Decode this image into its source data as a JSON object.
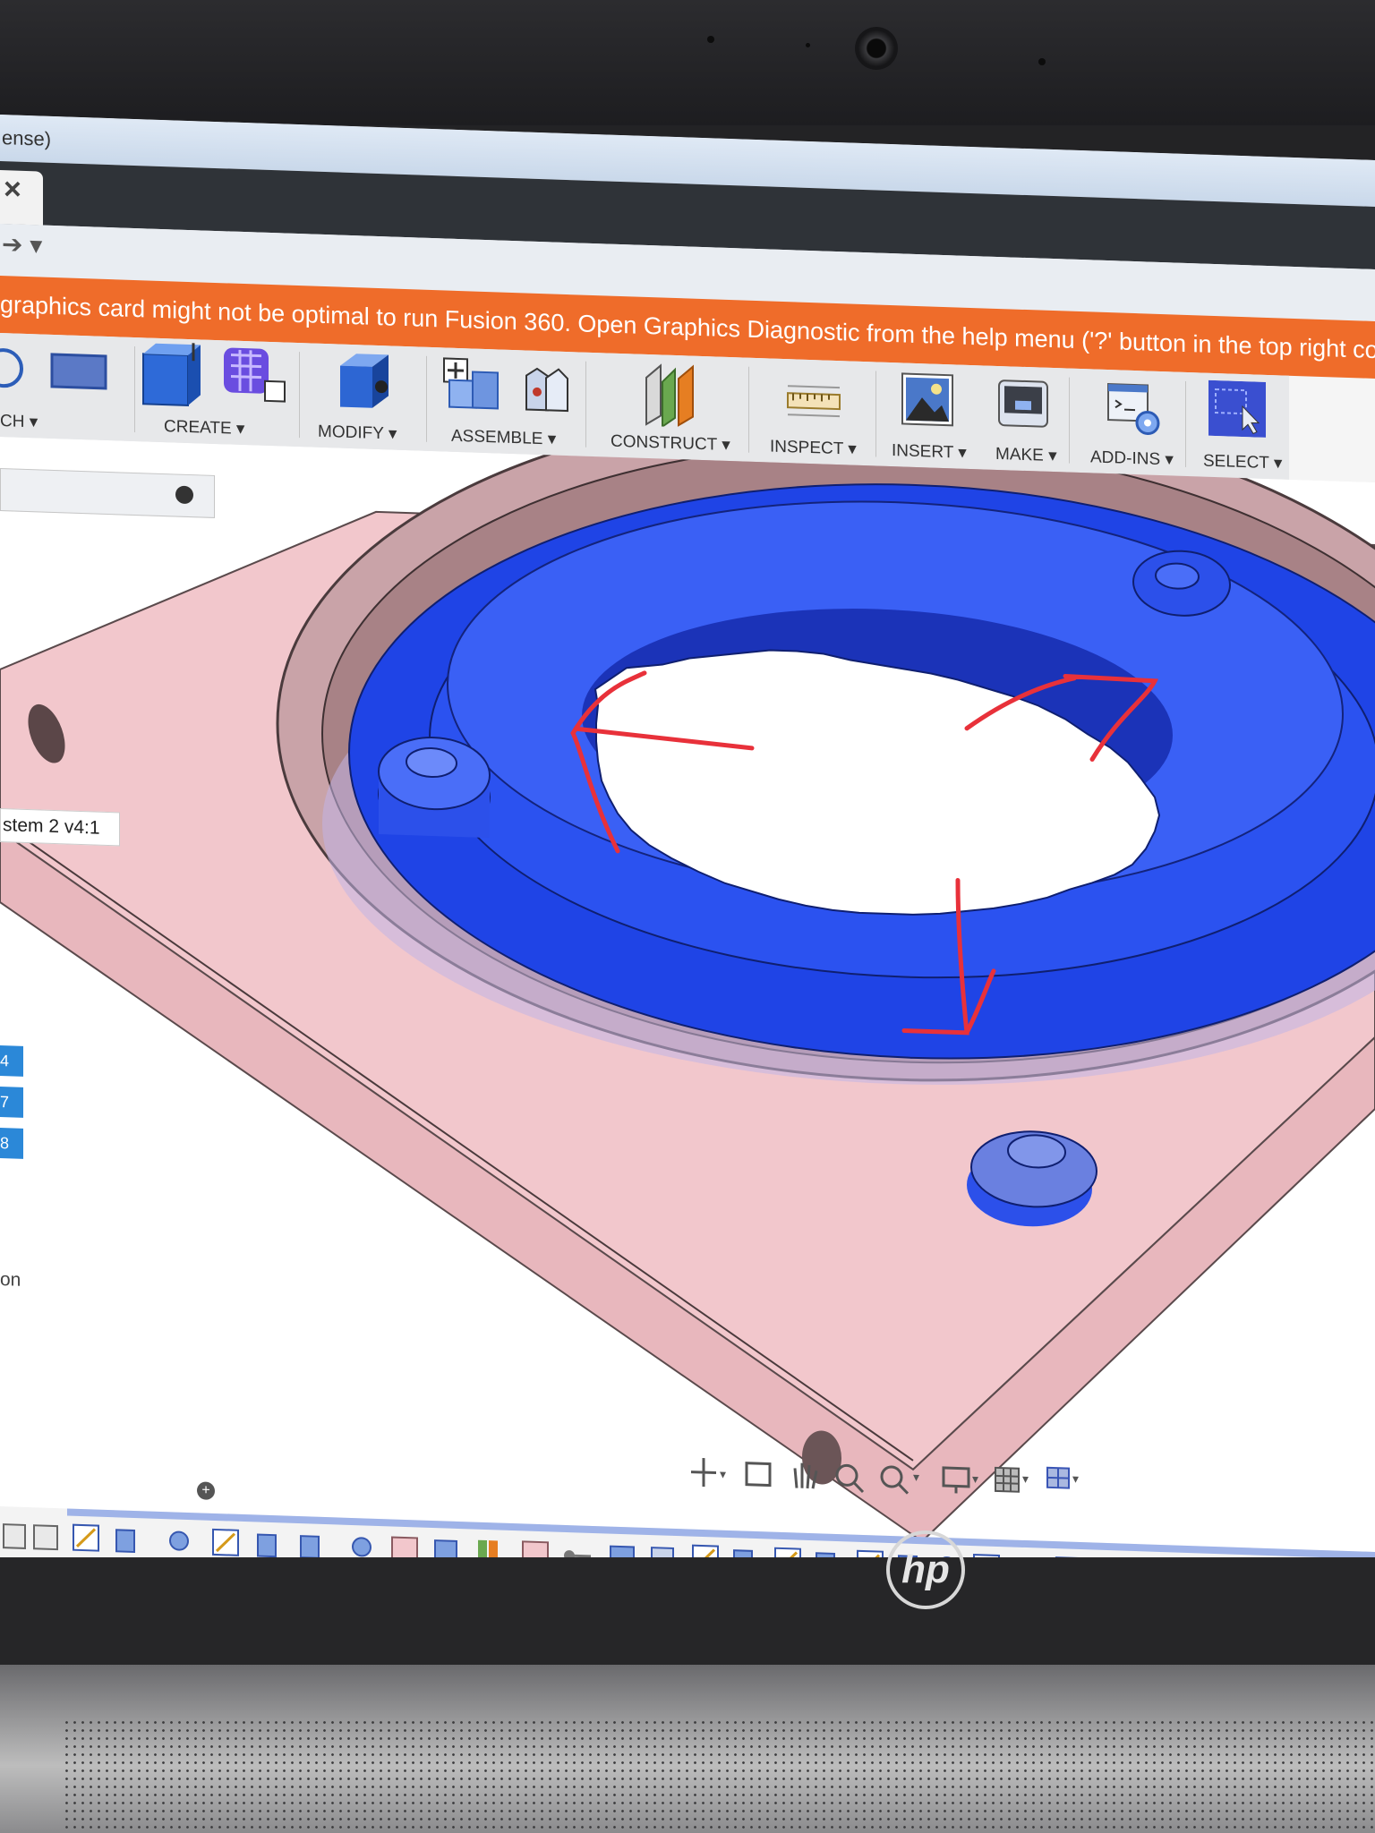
{
  "window": {
    "title_fragment": "ense)"
  },
  "tab": {
    "close_glyph": "×"
  },
  "warning": {
    "text": "graphics card might not be optimal to run Fusion 360. Open Graphics Diagnostic from the help menu ('?' button in the top right co"
  },
  "toolbar": {
    "groups": [
      {
        "label": "CH ▾",
        "icon": "sketch-icon"
      },
      {
        "label": "CREATE ▾",
        "icon": "extrude-icon"
      },
      {
        "label": "MODIFY ▾",
        "icon": "press-pull-icon"
      },
      {
        "label": "ASSEMBLE ▾",
        "icon": "new-component-icon"
      },
      {
        "label": "CONSTRUCT ▾",
        "icon": "offset-plane-icon"
      },
      {
        "label": "INSPECT ▾",
        "icon": "measure-icon"
      },
      {
        "label": "INSERT ▾",
        "icon": "insert-image-icon"
      },
      {
        "label": "MAKE ▾",
        "icon": "3d-print-icon"
      },
      {
        "label": "ADD-INS ▾",
        "icon": "scripts-addins-icon"
      },
      {
        "label": "SELECT ▾",
        "icon": "select-cursor-icon"
      }
    ]
  },
  "browser": {
    "component_label": "stem 2 v4:1",
    "side_badges": [
      "4",
      "7",
      "8"
    ],
    "side_text": "on"
  },
  "colors": {
    "warning_bg": "#ef6c2a",
    "body_pink": "#f0c5c9",
    "ring_gear_blue": "#1f3fe0",
    "annotation_red": "#e8313a",
    "select_active": "#3a4fd0"
  },
  "navigation": {
    "icons": [
      "orbit-icon",
      "look-at-icon",
      "pan-icon",
      "zoom-icon",
      "zoom-window-icon",
      "display-settings-icon",
      "grid-settings-icon",
      "viewports-icon"
    ]
  },
  "brand": {
    "laptop_logo": "hp"
  }
}
